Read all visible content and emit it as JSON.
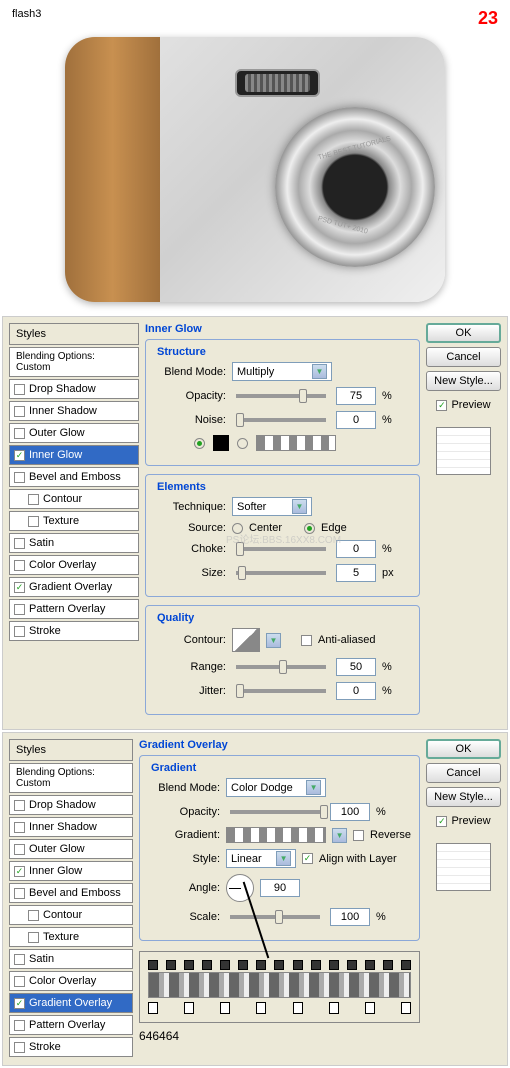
{
  "header": {
    "title": "flash3",
    "step": "23"
  },
  "camera": {
    "lens_top": "THE BEST TUTORIALS",
    "lens_bottom": "PSD TUT+ 2010"
  },
  "styles_panel": {
    "title": "Styles",
    "subtitle": "Blending Options: Custom",
    "items": [
      {
        "label": "Drop Shadow",
        "checked": false,
        "indent": false
      },
      {
        "label": "Inner Shadow",
        "checked": false,
        "indent": false
      },
      {
        "label": "Outer Glow",
        "checked": false,
        "indent": false
      },
      {
        "label": "Inner Glow",
        "checked": true,
        "indent": false
      },
      {
        "label": "Bevel and Emboss",
        "checked": false,
        "indent": false
      },
      {
        "label": "Contour",
        "checked": false,
        "indent": true
      },
      {
        "label": "Texture",
        "checked": false,
        "indent": true
      },
      {
        "label": "Satin",
        "checked": false,
        "indent": false
      },
      {
        "label": "Color Overlay",
        "checked": false,
        "indent": false
      },
      {
        "label": "Gradient Overlay",
        "checked": true,
        "indent": false
      },
      {
        "label": "Pattern Overlay",
        "checked": false,
        "indent": false
      },
      {
        "label": "Stroke",
        "checked": false,
        "indent": false
      }
    ]
  },
  "inner_glow": {
    "title": "Inner Glow",
    "structure": {
      "title": "Structure",
      "blend_mode_label": "Blend Mode:",
      "blend_mode": "Multiply",
      "opacity_label": "Opacity:",
      "opacity": "75",
      "noise_label": "Noise:",
      "noise": "0",
      "pct": "%"
    },
    "elements": {
      "title": "Elements",
      "technique_label": "Technique:",
      "technique": "Softer",
      "source_label": "Source:",
      "center": "Center",
      "edge": "Edge",
      "choke_label": "Choke:",
      "choke": "0",
      "size_label": "Size:",
      "size": "5",
      "px": "px",
      "pct": "%"
    },
    "quality": {
      "title": "Quality",
      "contour_label": "Contour:",
      "anti_aliased": "Anti-aliased",
      "range_label": "Range:",
      "range": "50",
      "jitter_label": "Jitter:",
      "jitter": "0",
      "pct": "%"
    }
  },
  "gradient_overlay": {
    "title": "Gradient Overlay",
    "gradient": {
      "title": "Gradient",
      "blend_mode_label": "Blend Mode:",
      "blend_mode": "Color Dodge",
      "opacity_label": "Opacity:",
      "opacity": "100",
      "gradient_label": "Gradient:",
      "reverse": "Reverse",
      "style_label": "Style:",
      "style": "Linear",
      "align": "Align with Layer",
      "angle_label": "Angle:",
      "angle": "90",
      "scale_label": "Scale:",
      "scale": "100",
      "pct": "%"
    },
    "hex": "646464"
  },
  "buttons": {
    "ok": "OK",
    "cancel": "Cancel",
    "new_style": "New Style...",
    "preview": "Preview"
  },
  "watermark": "PS论坛:BBS.16XX8.COM"
}
